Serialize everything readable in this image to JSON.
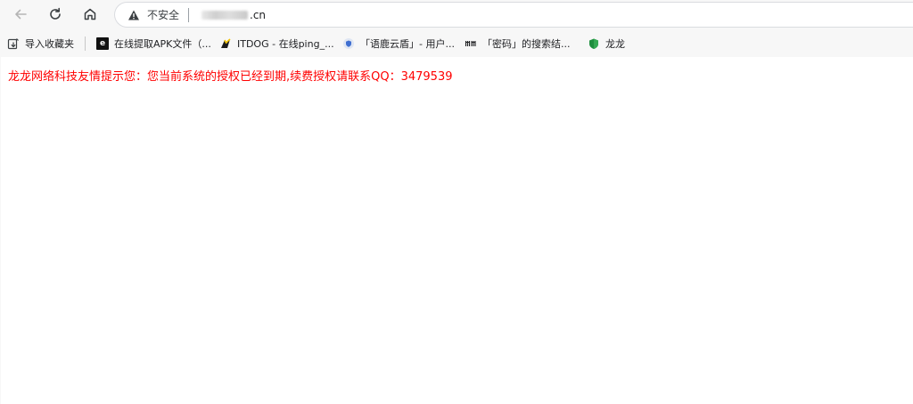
{
  "toolbar": {
    "security_label": "不安全",
    "url_visible": ".cn"
  },
  "bookmarks": [
    {
      "label": "导入收藏夹",
      "icon": "import-bookmarks-icon"
    },
    {
      "label": "在线提取APK文件（...",
      "icon": "apk-site-icon",
      "icon_text": "e"
    },
    {
      "label": "ITDOG - 在线ping_...",
      "icon": "itdog-icon"
    },
    {
      "label": "「语鹿云盾」- 用户...",
      "icon": "shield-badge-icon"
    },
    {
      "label": "「密码」的搜索结...",
      "icon": "search-site-icon",
      "icon_text": "mi"
    },
    {
      "label": "龙龙",
      "icon": "green-shield-icon"
    }
  ],
  "page": {
    "notice": "龙龙网络科技友情提示您：您当前系统的授权已经到期,续费授权请联系QQ：3479539"
  },
  "colors": {
    "notice": "#ff0000",
    "chrome": "#f7f7f7",
    "content": "#ffffff"
  }
}
